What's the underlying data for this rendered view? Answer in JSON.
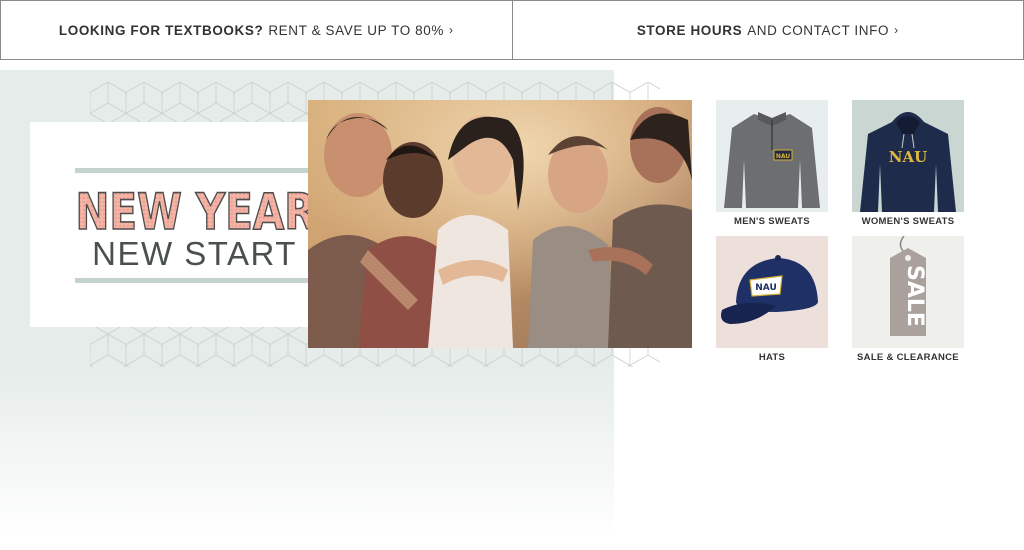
{
  "promo_bar": {
    "textbooks": {
      "strong": "LOOKING FOR TEXTBOOKS?",
      "light": "RENT & SAVE UP TO 80%",
      "chevron": "›"
    },
    "store": {
      "strong": "STORE HOURS",
      "light": "AND CONTACT INFO",
      "chevron": "›"
    }
  },
  "hero": {
    "headline": "NEW YEAR",
    "subheadline": "NEW START",
    "colors": {
      "headline_fill": "#f2a898",
      "headline_outline": "#4d4d4d",
      "rule": "#c4d3cf",
      "background": "#e5ece9"
    }
  },
  "categories": [
    {
      "label": "MEN'S SWEATS",
      "logo": "NAU",
      "icon": "quarter-zip-pullover-icon"
    },
    {
      "label": "WOMEN'S SWEATS",
      "logo": "NAU",
      "icon": "hoodie-icon"
    },
    {
      "label": "HATS",
      "logo": "NAU",
      "icon": "baseball-cap-icon"
    },
    {
      "label": "SALE & CLEARANCE",
      "tag": "SALE",
      "icon": "sale-tag-icon"
    }
  ]
}
